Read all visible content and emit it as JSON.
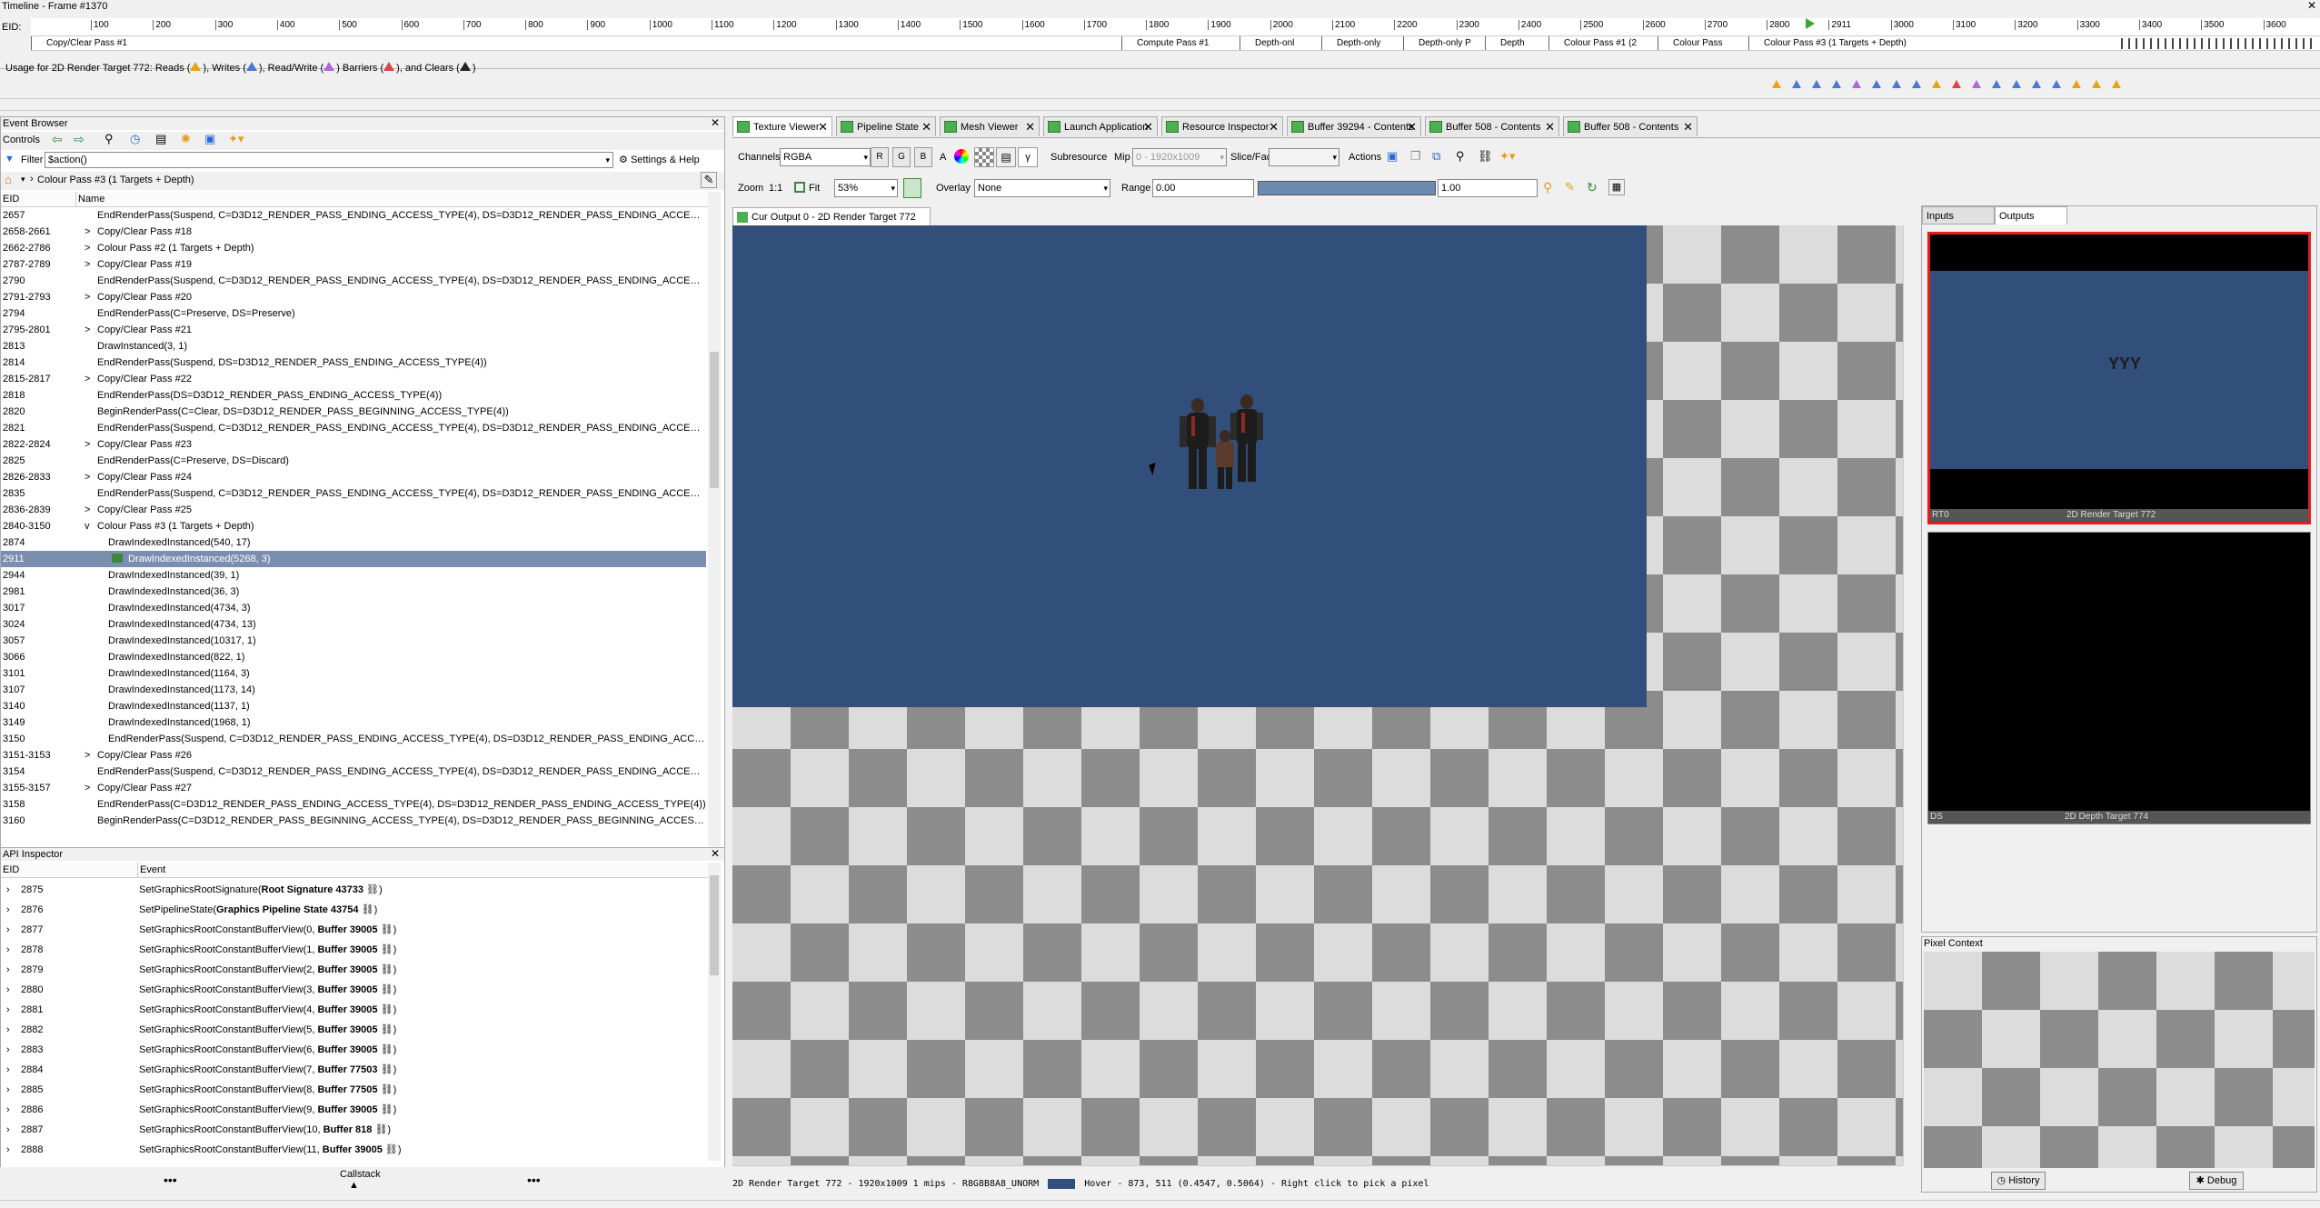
{
  "timeline": {
    "title": "Timeline - Frame #1370",
    "eid_label": "EID:",
    "ticks": [
      "100",
      "200",
      "300",
      "400",
      "500",
      "600",
      "700",
      "800",
      "900",
      "1000",
      "1100",
      "1200",
      "1300",
      "1400",
      "1500",
      "1600",
      "1700",
      "1800",
      "1900",
      "2000",
      "2100",
      "2200",
      "2300",
      "2400",
      "2500",
      "2600",
      "2700",
      "2800",
      "2911",
      "3000",
      "3100",
      "3200",
      "3300",
      "3400",
      "3500",
      "3600"
    ],
    "passes": [
      "Copy/Clear Pass #1",
      "Compute Pass #1",
      "Depth-onl",
      "Depth-only",
      "Depth-only P",
      "Depth",
      "Colour Pass #1 (2",
      "Colour Pass",
      "Colour Pass #3 (1 Targets + Depth)"
    ],
    "usage_text": "Usage for 2D Render Target 772: Reads (",
    "usage_writes": "), Writes (",
    "usage_rw": "), Read/Write (",
    "usage_barriers": ") Barriers (",
    "usage_clears": "), and Clears (",
    "usage_end": ")"
  },
  "event_browser": {
    "title": "Event Browser",
    "controls_label": "Controls",
    "filter_label": "Filter",
    "filter_value": "$action()",
    "settings_label": "Settings & Help",
    "breadcrumb": "Colour Pass #3 (1 Targets + Depth)",
    "col_eid": "EID",
    "col_name": "Name",
    "rows": [
      {
        "eid": "2657",
        "name": "EndRenderPass(Suspend, C=D3D12_RENDER_PASS_ENDING_ACCESS_TYPE(4), DS=D3D12_RENDER_PASS_ENDING_ACCESS_TYPE(4))",
        "expand": ""
      },
      {
        "eid": "2658-2661",
        "name": "Copy/Clear Pass #18",
        "expand": ">"
      },
      {
        "eid": "2662-2786",
        "name": "Colour Pass #2 (1 Targets + Depth)",
        "expand": ">"
      },
      {
        "eid": "2787-2789",
        "name": "Copy/Clear Pass #19",
        "expand": ">"
      },
      {
        "eid": "2790",
        "name": "EndRenderPass(Suspend, C=D3D12_RENDER_PASS_ENDING_ACCESS_TYPE(4), DS=D3D12_RENDER_PASS_ENDING_ACCESS_TYPE(4))",
        "expand": ""
      },
      {
        "eid": "2791-2793",
        "name": "Copy/Clear Pass #20",
        "expand": ">"
      },
      {
        "eid": "2794",
        "name": "EndRenderPass(C=Preserve, DS=Preserve)",
        "expand": ""
      },
      {
        "eid": "2795-2801",
        "name": "Copy/Clear Pass #21",
        "expand": ">"
      },
      {
        "eid": "2813",
        "name": "DrawInstanced(3, 1)",
        "expand": ""
      },
      {
        "eid": "2814",
        "name": "EndRenderPass(Suspend, DS=D3D12_RENDER_PASS_ENDING_ACCESS_TYPE(4))",
        "expand": ""
      },
      {
        "eid": "2815-2817",
        "name": "Copy/Clear Pass #22",
        "expand": ">"
      },
      {
        "eid": "2818",
        "name": "EndRenderPass(DS=D3D12_RENDER_PASS_ENDING_ACCESS_TYPE(4))",
        "expand": ""
      },
      {
        "eid": "2820",
        "name": "BeginRenderPass(C=Clear, DS=D3D12_RENDER_PASS_BEGINNING_ACCESS_TYPE(4))",
        "expand": ""
      },
      {
        "eid": "2821",
        "name": "EndRenderPass(Suspend, C=D3D12_RENDER_PASS_ENDING_ACCESS_TYPE(4), DS=D3D12_RENDER_PASS_ENDING_ACCESS_TYPE(4))",
        "expand": ""
      },
      {
        "eid": "2822-2824",
        "name": "Copy/Clear Pass #23",
        "expand": ">"
      },
      {
        "eid": "2825",
        "name": "EndRenderPass(C=Preserve, DS=Discard)",
        "expand": ""
      },
      {
        "eid": "2826-2833",
        "name": "Copy/Clear Pass #24",
        "expand": ">"
      },
      {
        "eid": "2835",
        "name": "EndRenderPass(Suspend, C=D3D12_RENDER_PASS_ENDING_ACCESS_TYPE(4), DS=D3D12_RENDER_PASS_ENDING_ACCESS_TYPE(4))",
        "expand": ""
      },
      {
        "eid": "2836-2839",
        "name": "Copy/Clear Pass #25",
        "expand": ">"
      },
      {
        "eid": "2840-3150",
        "name": "Colour Pass #3 (1 Targets + Depth)",
        "expand": "v"
      },
      {
        "eid": "2874",
        "name": "DrawIndexedInstanced(540, 17)",
        "expand": "",
        "indent": 1
      },
      {
        "eid": "2911",
        "name": "DrawIndexedInstanced(5268, 3)",
        "expand": "",
        "indent": 1,
        "selected": true
      },
      {
        "eid": "2944",
        "name": "DrawIndexedInstanced(39, 1)",
        "expand": "",
        "indent": 1
      },
      {
        "eid": "2981",
        "name": "DrawIndexedInstanced(36, 3)",
        "expand": "",
        "indent": 1
      },
      {
        "eid": "3017",
        "name": "DrawIndexedInstanced(4734, 3)",
        "expand": "",
        "indent": 1
      },
      {
        "eid": "3024",
        "name": "DrawIndexedInstanced(4734, 13)",
        "expand": "",
        "indent": 1
      },
      {
        "eid": "3057",
        "name": "DrawIndexedInstanced(10317, 1)",
        "expand": "",
        "indent": 1
      },
      {
        "eid": "3066",
        "name": "DrawIndexedInstanced(822, 1)",
        "expand": "",
        "indent": 1
      },
      {
        "eid": "3101",
        "name": "DrawIndexedInstanced(1164, 3)",
        "expand": "",
        "indent": 1
      },
      {
        "eid": "3107",
        "name": "DrawIndexedInstanced(1173, 14)",
        "expand": "",
        "indent": 1
      },
      {
        "eid": "3140",
        "name": "DrawIndexedInstanced(1137, 1)",
        "expand": "",
        "indent": 1
      },
      {
        "eid": "3149",
        "name": "DrawIndexedInstanced(1968, 1)",
        "expand": "",
        "indent": 1
      },
      {
        "eid": "3150",
        "name": "EndRenderPass(Suspend, C=D3D12_RENDER_PASS_ENDING_ACCESS_TYPE(4), DS=D3D12_RENDER_PASS_ENDING_ACCESS_TYPE(...",
        "expand": "",
        "indent": 1
      },
      {
        "eid": "3151-3153",
        "name": "Copy/Clear Pass #26",
        "expand": ">"
      },
      {
        "eid": "3154",
        "name": "EndRenderPass(Suspend, C=D3D12_RENDER_PASS_ENDING_ACCESS_TYPE(4), DS=D3D12_RENDER_PASS_ENDING_ACCESS_TYPE(4))",
        "expand": ""
      },
      {
        "eid": "3155-3157",
        "name": "Copy/Clear Pass #27",
        "expand": ">"
      },
      {
        "eid": "3158",
        "name": "EndRenderPass(C=D3D12_RENDER_PASS_ENDING_ACCESS_TYPE(4), DS=D3D12_RENDER_PASS_ENDING_ACCESS_TYPE(4))",
        "expand": ""
      },
      {
        "eid": "3160",
        "name": "BeginRenderPass(C=D3D12_RENDER_PASS_BEGINNING_ACCESS_TYPE(4), DS=D3D12_RENDER_PASS_BEGINNING_ACCESS_TYPE(4))",
        "expand": ""
      }
    ]
  },
  "api_inspector": {
    "title": "API Inspector",
    "col_eid": "EID",
    "col_event": "Event",
    "rows": [
      {
        "eid": "2875",
        "pre": "SetGraphicsRootSignature(",
        "bold": "Root Signature 43733",
        "post": ")"
      },
      {
        "eid": "2876",
        "pre": "SetPipelineState(",
        "bold": "Graphics Pipeline State 43754",
        "post": ")"
      },
      {
        "eid": "2877",
        "pre": "SetGraphicsRootConstantBufferView(0, ",
        "bold": "Buffer 39005",
        "post": ")"
      },
      {
        "eid": "2878",
        "pre": "SetGraphicsRootConstantBufferView(1, ",
        "bold": "Buffer 39005",
        "post": ")"
      },
      {
        "eid": "2879",
        "pre": "SetGraphicsRootConstantBufferView(2, ",
        "bold": "Buffer 39005",
        "post": ")"
      },
      {
        "eid": "2880",
        "pre": "SetGraphicsRootConstantBufferView(3, ",
        "bold": "Buffer 39005",
        "post": ")"
      },
      {
        "eid": "2881",
        "pre": "SetGraphicsRootConstantBufferView(4, ",
        "bold": "Buffer 39005",
        "post": ")"
      },
      {
        "eid": "2882",
        "pre": "SetGraphicsRootConstantBufferView(5, ",
        "bold": "Buffer 39005",
        "post": ")"
      },
      {
        "eid": "2883",
        "pre": "SetGraphicsRootConstantBufferView(6, ",
        "bold": "Buffer 39005",
        "post": ")"
      },
      {
        "eid": "2884",
        "pre": "SetGraphicsRootConstantBufferView(7, ",
        "bold": "Buffer 77503",
        "post": ")"
      },
      {
        "eid": "2885",
        "pre": "SetGraphicsRootConstantBufferView(8, ",
        "bold": "Buffer 77505",
        "post": ")"
      },
      {
        "eid": "2886",
        "pre": "SetGraphicsRootConstantBufferView(9, ",
        "bold": "Buffer 39005",
        "post": ")"
      },
      {
        "eid": "2887",
        "pre": "SetGraphicsRootConstantBufferView(10, ",
        "bold": "Buffer 818",
        "post": ")"
      },
      {
        "eid": "2888",
        "pre": "SetGraphicsRootConstantBufferView(11, ",
        "bold": "Buffer 39005",
        "post": ")"
      }
    ],
    "callstack_label": "Callstack"
  },
  "tabs": [
    {
      "label": "Texture Viewer",
      "active": true
    },
    {
      "label": "Pipeline State"
    },
    {
      "label": "Mesh Viewer"
    },
    {
      "label": "Launch Application"
    },
    {
      "label": "Resource Inspector"
    },
    {
      "label": "Buffer 39294 - Contents"
    },
    {
      "label": "Buffer 508 - Contents"
    },
    {
      "label": "Buffer 508 - Contents"
    }
  ],
  "toolbar": {
    "channels_label": "Channels",
    "channels_value": "RGBA",
    "ch_r": "R",
    "ch_g": "G",
    "ch_b": "B",
    "ch_a": "A",
    "subresource_label": "Subresource",
    "mip_label": "Mip",
    "mip_value": "0 - 1920x1009",
    "slice_label": "Slice/Face",
    "actions_label": "Actions",
    "zoom_label": "Zoom",
    "zoom_1to1": "1:1",
    "fit_label": "Fit",
    "zoom_value": "53%",
    "overlay_label": "Overlay",
    "overlay_value": "None",
    "range_label": "Range",
    "range_min": "0.00",
    "range_max": "1.00"
  },
  "texture": {
    "tab_label": "Cur Output 0 - 2D Render Target 772",
    "bg_color": "#324f7b"
  },
  "status_bar": {
    "info": "2D Render Target 772 - 1920x1009 1 mips - R8G8B8A8_UNORM",
    "hover": "Hover -   873, 511 (0.4547, 0.5064) - Right click to pick a pixel"
  },
  "right_panel": {
    "tab_inputs": "Inputs",
    "tab_outputs": "Outputs",
    "thumb1_slot": "RT0",
    "thumb1_label": "2D Render Target 772",
    "thumb2_slot": "DS",
    "thumb2_label": "2D Depth Target 774",
    "pixel_context_title": "Pixel Context",
    "history_label": "History",
    "debug_label": "Debug"
  }
}
